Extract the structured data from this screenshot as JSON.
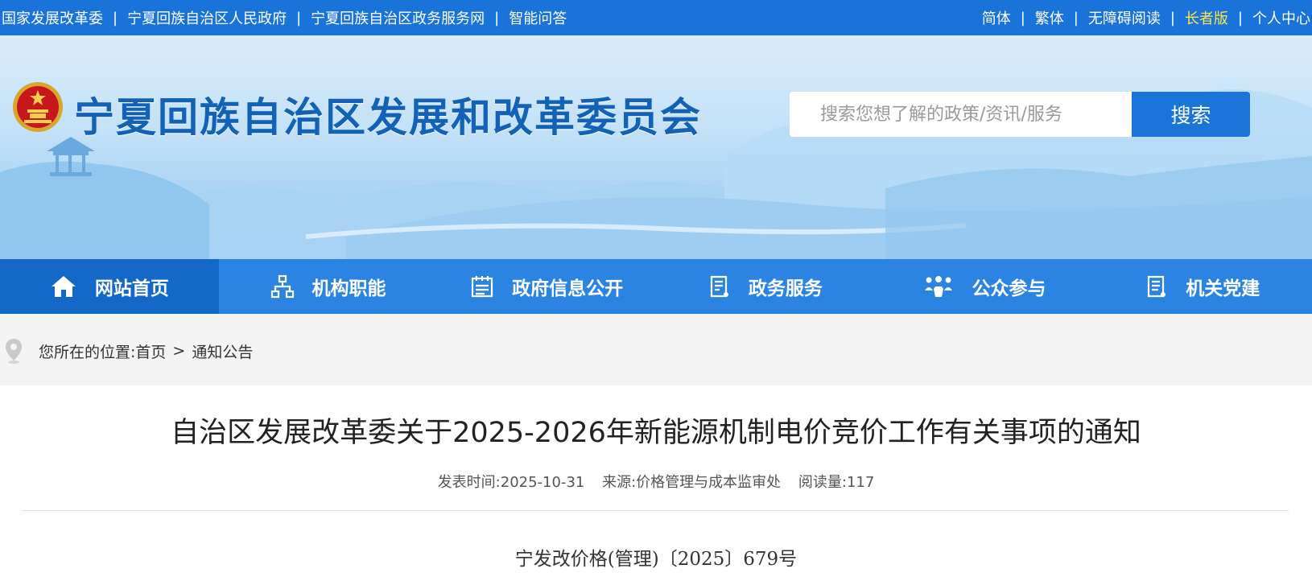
{
  "topbar": {
    "left_links": [
      "国家发展改革委",
      "宁夏回族自治区人民政府",
      "宁夏回族自治区政务服务网",
      "智能问答"
    ],
    "right_links": [
      "简体",
      "繁体",
      "无障碍阅读",
      "长者版",
      "个人中心"
    ],
    "separator": "|",
    "bg_color": "#1a73d9",
    "elder_color": "#ffe34f"
  },
  "header": {
    "site_title": "宁夏回族自治区发展和改革委员会",
    "emblem_icon": "national-emblem-icon"
  },
  "search": {
    "placeholder": "搜索您想了解的政策/资讯/服务",
    "button_label": "搜索"
  },
  "nav": {
    "items": [
      {
        "label": "网站首页",
        "icon": "home-icon"
      },
      {
        "label": "机构职能",
        "icon": "org-chart-icon"
      },
      {
        "label": "政府信息公开",
        "icon": "calendar-list-icon"
      },
      {
        "label": "政务服务",
        "icon": "document-list-icon"
      },
      {
        "label": "公众参与",
        "icon": "people-icon"
      },
      {
        "label": "机关党建",
        "icon": "document-lines-icon"
      }
    ],
    "bg_color": "#2b84e1",
    "active_color": "#1469c8"
  },
  "breadcrumb": {
    "prefix": "您所在的位置:",
    "home": "首页",
    "separator": ">",
    "current": "通知公告"
  },
  "article": {
    "title": "自治区发展改革委关于2025-2026年新能源机制电价竞价工作有关事项的通知",
    "meta": {
      "publish": "发表时间:2025-10-31",
      "source": "来源:价格管理与成本监审处",
      "reads": "阅读量:117"
    },
    "doc_number": "宁发改价格(管理)〔2025〕679号"
  }
}
